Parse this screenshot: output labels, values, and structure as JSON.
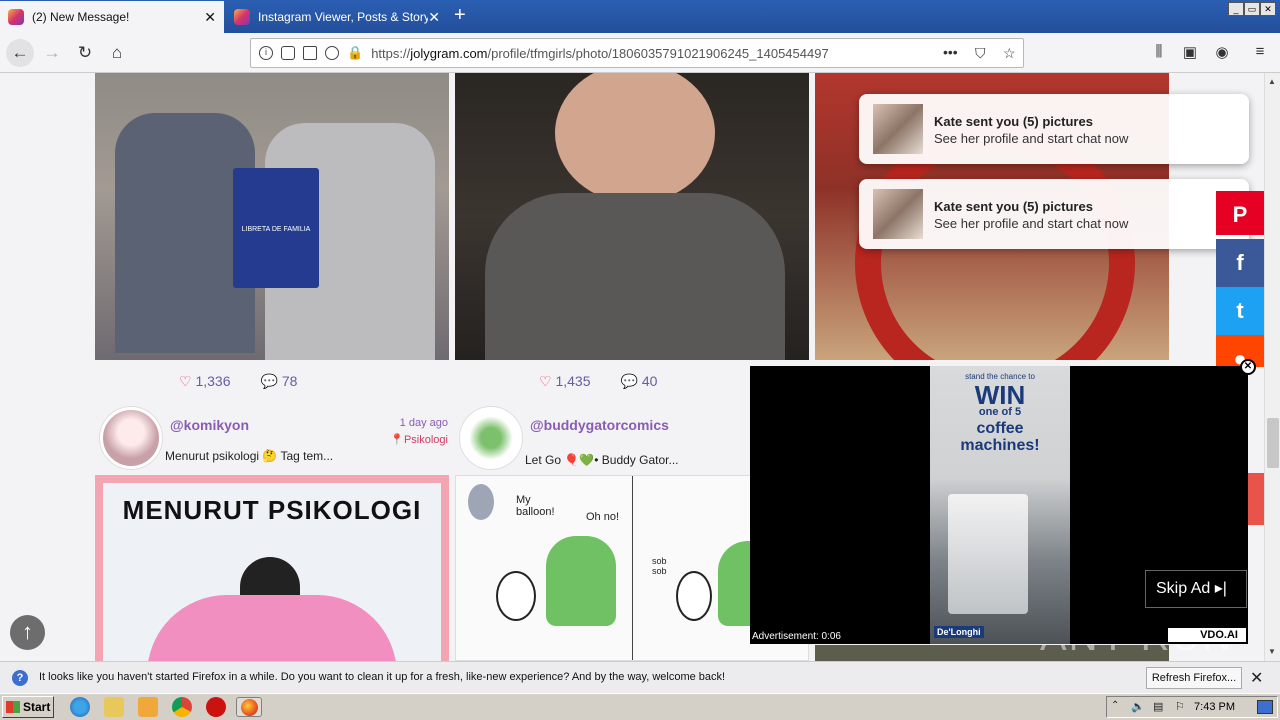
{
  "tabs": [
    {
      "title": "(2) New Message!",
      "close": "✕"
    },
    {
      "title": "Instagram Viewer, Posts & Story ⚙",
      "close": "✕"
    }
  ],
  "new_tab": "+",
  "window_controls": [
    "_",
    "▭",
    "✕"
  ],
  "nav": {
    "url_prefix": "https://",
    "url_domain": "jolygram.com",
    "url_path": "/profile/tfmgirls/photo/1806035791021906245_1405454497",
    "more": "•••"
  },
  "posts_row1": [
    {
      "likes": "1,336",
      "comments": "78"
    },
    {
      "likes": "1,435",
      "comments": "40"
    },
    {
      "likes": "",
      "comments": ""
    }
  ],
  "notifications": [
    {
      "title": "Kate sent you (5) pictures",
      "subtitle": "See her profile and start chat now"
    },
    {
      "title": "Kate sent you (5) pictures",
      "subtitle": "See her profile and start chat now"
    }
  ],
  "posts_row2": [
    {
      "username": "@komikyon",
      "time": "1 day ago",
      "location": "Psikologi",
      "caption": "Menurut psikologi 🤔 Tag tem..."
    },
    {
      "username": "@buddygatorcomics",
      "time": "",
      "location": "",
      "caption": "Let Go 🎈💚• Buddy Gator..."
    }
  ],
  "post_images": {
    "libreta": "LIBRETA DE FAMILIA",
    "menurut": "MENURUT PSIKOLOGI",
    "comic1": "My balloon!",
    "comic2": "Oh no!",
    "comic3": "sob sob"
  },
  "share_icons": [
    "pinterest-icon",
    "facebook-icon",
    "twitter-icon",
    "reddit-icon"
  ],
  "ad": {
    "headline1": "stand the chance to",
    "headline2": "WIN",
    "headline3": "one of 5",
    "headline4": "coffee machines!",
    "brand": "De'Longhi",
    "skip": "Skip Ad ▸|",
    "label": "Advertisement: 0:06",
    "network": "VDO.AI",
    "close": "✕"
  },
  "watermark": "ANY RUN",
  "infobar": {
    "text": "It looks like you haven't started Firefox in a while. Do you want to clean it up for a fresh, like-new experience? And by the way, welcome back!",
    "button": "Refresh Firefox...",
    "close": "✕"
  },
  "taskbar": {
    "start": "Start",
    "clock": "7:43 PM"
  },
  "colors": {
    "tabstrip": "#2b5fb3",
    "accent_purple": "#8a5cb5",
    "pinterest": "#e60023",
    "facebook": "#3b5998",
    "twitter": "#1da1f2",
    "reddit": "#ff4500"
  }
}
